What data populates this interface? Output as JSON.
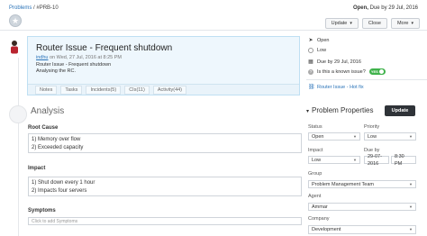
{
  "header": {
    "breadcrumb_root": "Problems",
    "breadcrumb_sep": "/",
    "breadcrumb_id": "#PRB-10",
    "status": "Open,",
    "due": "Due by 29 Jul, 2016",
    "buttons": {
      "update": "Update",
      "update_caret": "▾",
      "close": "Close",
      "more": "More",
      "more_caret": "▾"
    }
  },
  "problem": {
    "title": "Router Issue - Frequent shutdown",
    "author": "indhu",
    "posted": "on Wed, 27 Jul, 2016 at 8:25 PM",
    "body_line1": "Router Issue - Frequent shutdown",
    "body_line2": "Analysing the RC.",
    "tabs": [
      "Notes",
      "Tasks",
      "Incidents(5)",
      "CIs(11)",
      "Activity(44)"
    ]
  },
  "analysis": {
    "title": "Analysis",
    "root_cause_label": "Root Cause",
    "root_cause_lines": [
      "1) Memory over flow",
      "2) Exceeded capacity"
    ],
    "impact_label": "Impact",
    "impact_lines": [
      "1) Shut down every 1 hour",
      "2) Impacts four servers"
    ],
    "symptoms_label": "Symptoms",
    "symptoms_placeholder": "Click to add Symptoms"
  },
  "status_panel": {
    "open": "Open",
    "low": "Low",
    "due": "Due by 29 Jul, 2016",
    "known_issue_q": "Is this a known issue?",
    "known_issue_toggle": "YES",
    "linked": "Router Issue - Hot fix"
  },
  "properties": {
    "title": "Problem Properties",
    "update_button": "Update",
    "status_label": "Status",
    "status_value": "Open",
    "priority_label": "Priority",
    "priority_value": "Low",
    "impact_label": "Impact",
    "impact_value": "Low",
    "due_label": "Due by",
    "due_date": "29-07-2016",
    "due_time": "8:30 PM",
    "group_label": "Group",
    "group_value": "Problem Management Team",
    "agent_label": "Agent",
    "agent_value": "Ammar",
    "company_label": "Company",
    "company_value": "Development"
  },
  "colors": {
    "link": "#2a73b8",
    "card_bg": "#eef7fd",
    "card_border": "#bfe0f3",
    "toggle_on": "#3fb24b",
    "update_btn": "#2f3338"
  }
}
